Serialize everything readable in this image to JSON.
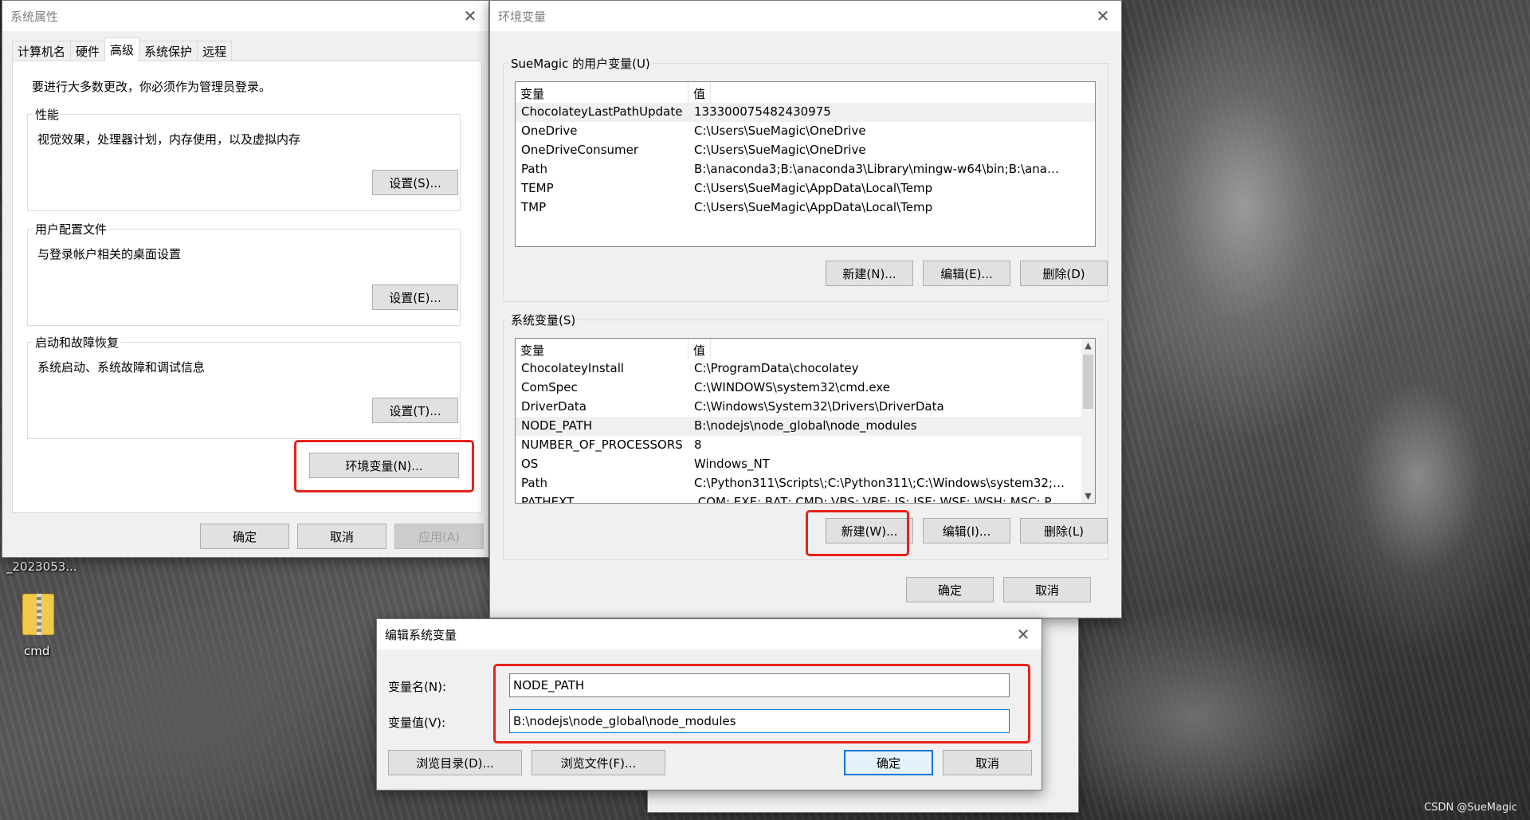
{
  "desktop": {
    "icon1_label": "_2023053...",
    "icon2_label": "cmd",
    "watermark": "CSDN @SueMagic"
  },
  "sys_props": {
    "title": "系统属性",
    "tabs": [
      "计算机名",
      "硬件",
      "高级",
      "系统保护",
      "远程"
    ],
    "active_tab": "高级",
    "admin_note": "要进行大多数更改，你必须作为管理员登录。",
    "perf": {
      "title": "性能",
      "desc": "视觉效果，处理器计划，内存使用，以及虚拟内存",
      "button": "设置(S)..."
    },
    "profile": {
      "title": "用户配置文件",
      "desc": "与登录帐户相关的桌面设置",
      "button": "设置(E)..."
    },
    "startup": {
      "title": "启动和故障恢复",
      "desc": "系统启动、系统故障和调试信息",
      "button": "设置(T)..."
    },
    "env_button": "环境变量(N)...",
    "ok": "确定",
    "cancel": "取消",
    "apply": "应用(A)"
  },
  "env": {
    "title": "环境变量",
    "user_section": "SueMagic 的用户变量(U)",
    "headers": {
      "var": "变量",
      "val": "值"
    },
    "user_vars": [
      {
        "name": "ChocolateyLastPathUpdate",
        "value": "133300075482430975"
      },
      {
        "name": "OneDrive",
        "value": "C:\\Users\\SueMagic\\OneDrive"
      },
      {
        "name": "OneDriveConsumer",
        "value": "C:\\Users\\SueMagic\\OneDrive"
      },
      {
        "name": "Path",
        "value": "B:\\anaconda3;B:\\anaconda3\\Library\\mingw-w64\\bin;B:\\anacond..."
      },
      {
        "name": "TEMP",
        "value": "C:\\Users\\SueMagic\\AppData\\Local\\Temp"
      },
      {
        "name": "TMP",
        "value": "C:\\Users\\SueMagic\\AppData\\Local\\Temp"
      }
    ],
    "user_buttons": {
      "new": "新建(N)...",
      "edit": "编辑(E)...",
      "delete": "删除(D)"
    },
    "sys_section": "系统变量(S)",
    "sys_vars": [
      {
        "name": "ChocolateyInstall",
        "value": "C:\\ProgramData\\chocolatey"
      },
      {
        "name": "ComSpec",
        "value": "C:\\WINDOWS\\system32\\cmd.exe"
      },
      {
        "name": "DriverData",
        "value": "C:\\Windows\\System32\\Drivers\\DriverData"
      },
      {
        "name": "NODE_PATH",
        "value": "B:\\nodejs\\node_global\\node_modules"
      },
      {
        "name": "NUMBER_OF_PROCESSORS",
        "value": "8"
      },
      {
        "name": "OS",
        "value": "Windows_NT"
      },
      {
        "name": "Path",
        "value": "C:\\Python311\\Scripts\\;C:\\Python311\\;C:\\Windows\\system32;C:\\..."
      },
      {
        "name": "PATHEXT",
        "value": ".COM;.EXE;.BAT;.CMD;.VBS;.VBE;.JS;.JSE;.WSF;.WSH;.MSC;.PY;.PYW"
      }
    ],
    "sys_buttons": {
      "new": "新建(W)...",
      "edit": "编辑(I)...",
      "delete": "删除(L)"
    },
    "ok": "确定",
    "cancel": "取消"
  },
  "edit_dialog": {
    "title": "编辑系统变量",
    "name_label": "变量名(N):",
    "value_label": "变量值(V):",
    "name_value": "NODE_PATH",
    "value_value": "B:\\nodejs\\node_global\\node_modules",
    "browse_dir": "浏览目录(D)...",
    "browse_file": "浏览文件(F)...",
    "ok": "确定",
    "cancel": "取消"
  },
  "colors": {
    "highlight_red": "#e8221b",
    "focus_blue": "#0078d7"
  }
}
